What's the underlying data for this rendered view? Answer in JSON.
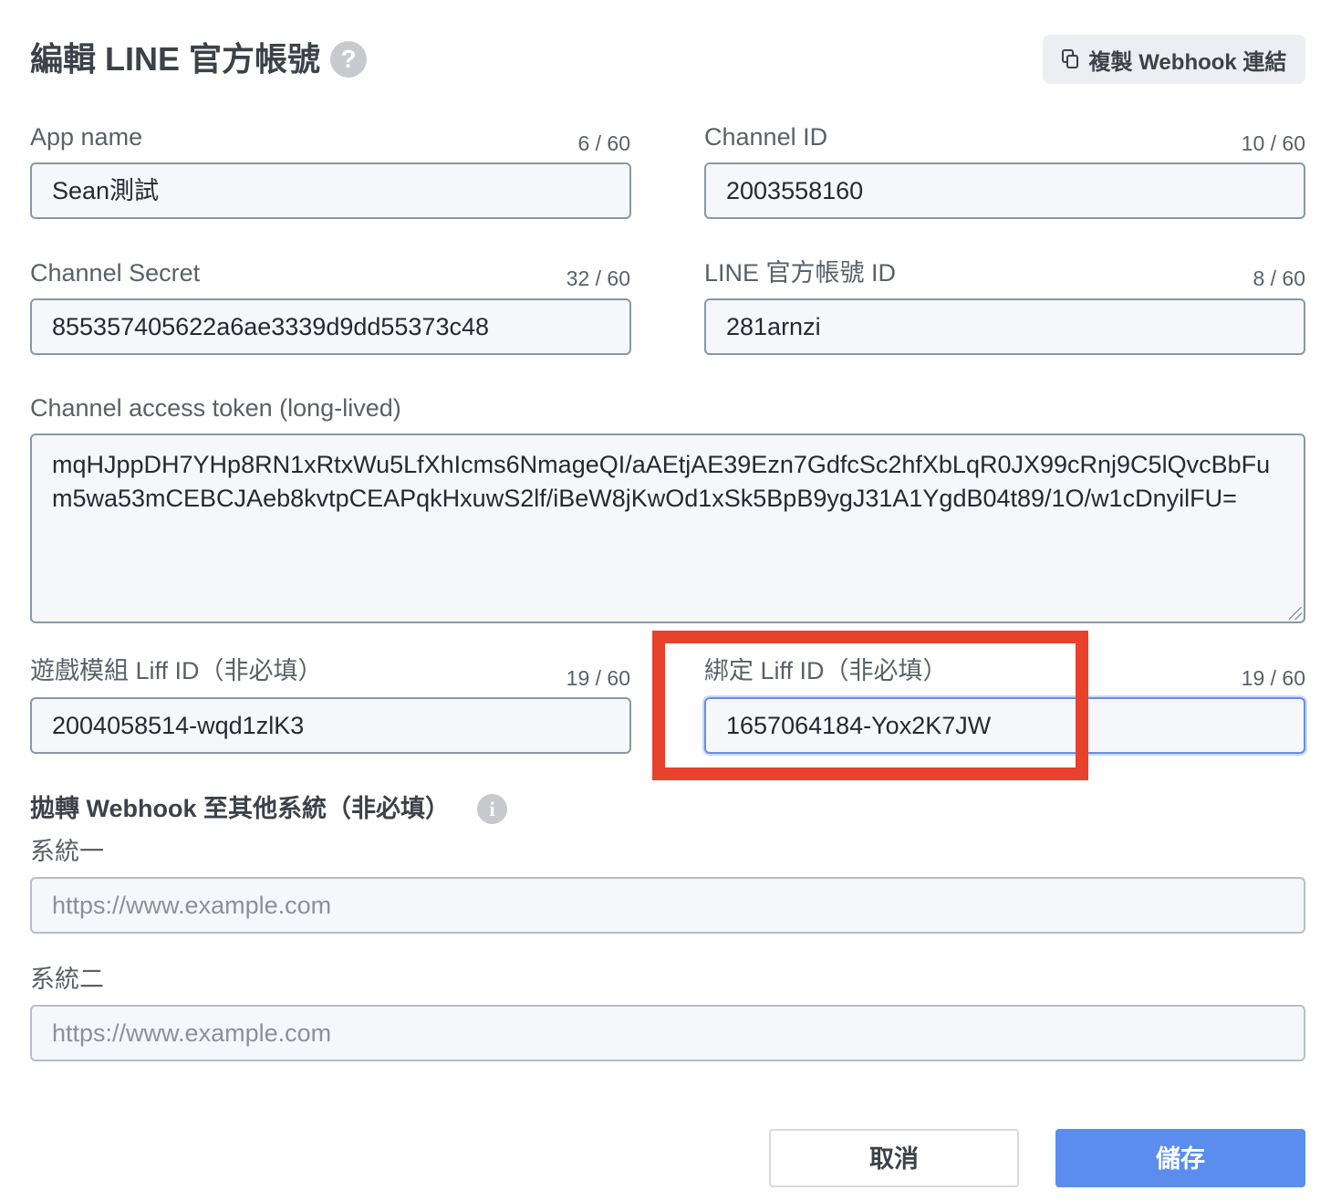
{
  "header": {
    "title": "編輯 LINE 官方帳號",
    "help_icon": "?",
    "copy_webhook_label": "複製 Webhook 連結"
  },
  "fields": {
    "app_name": {
      "label": "App name",
      "counter": "6 / 60",
      "value": "Sean測試"
    },
    "channel_id": {
      "label": "Channel ID",
      "counter": "10 / 60",
      "value": "2003558160"
    },
    "channel_secret": {
      "label": "Channel Secret",
      "counter": "32 / 60",
      "value": "855357405622a6ae3339d9dd55373c48"
    },
    "line_oa_id": {
      "label": "LINE 官方帳號 ID",
      "counter": "8 / 60",
      "value": "281arnzi"
    },
    "access_token": {
      "label": "Channel access token (long-lived)",
      "value": "mqHJppDH7YHp8RN1xRtxWu5LfXhIcms6NmageQI/aAEtjAE39Ezn7GdfcSc2hfXbLqR0JX99cRnj9C5lQvcBbFum5wa53mCEBCJAeb8kvtpCEAPqkHxuwS2lf/iBeW8jKwOd1xSk5BpB9ygJ31A1YgdB04t89/1O/w1cDnyilFU="
    },
    "game_liff_id": {
      "label": "遊戲模組 Liff ID（非必填）",
      "counter": "19 / 60",
      "value": "2004058514-wqd1zlK3"
    },
    "bind_liff_id": {
      "label": "綁定 Liff ID（非必填）",
      "counter": "19 / 60",
      "value": "1657064184-Yox2K7JW"
    }
  },
  "webhook_section": {
    "title": "拋轉 Webhook 至其他系統（非必填）",
    "info_icon": "i",
    "system1": {
      "label": "系統一",
      "placeholder": "https://www.example.com"
    },
    "system2": {
      "label": "系統二",
      "placeholder": "https://www.example.com"
    }
  },
  "footer": {
    "cancel_label": "取消",
    "save_label": "儲存"
  },
  "colors": {
    "primary": "#5b8def",
    "highlight": "#e8412c",
    "field_border": "#8c96a6"
  }
}
